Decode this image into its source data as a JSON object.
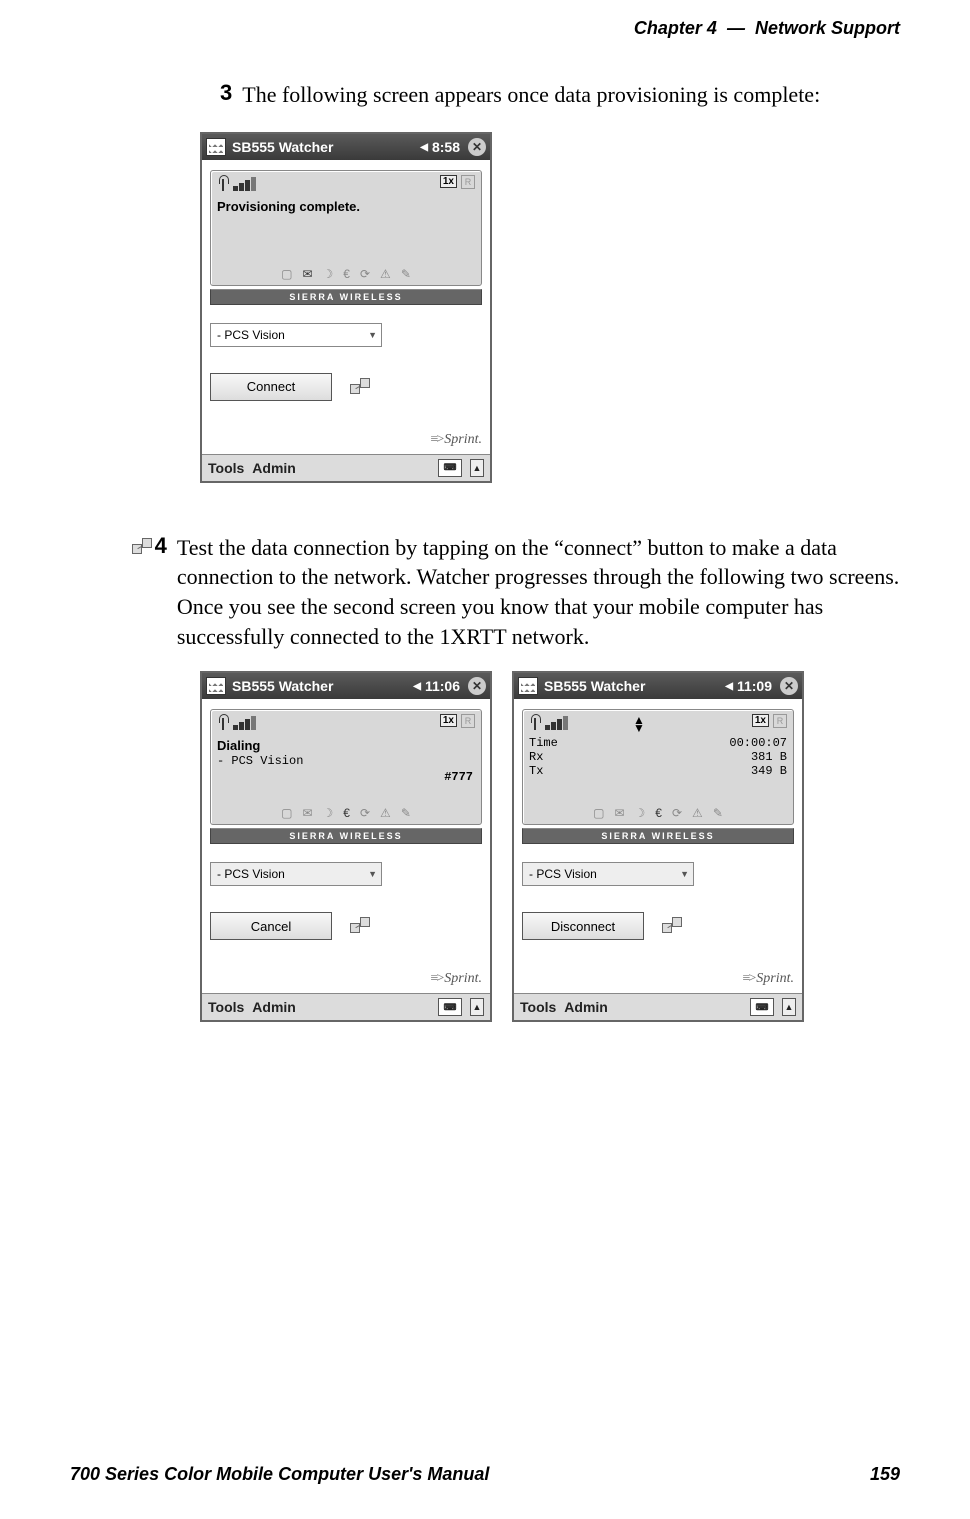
{
  "header": {
    "chapter": "Chapter  4",
    "separator": "—",
    "title": "Network Support"
  },
  "footer": {
    "manual_title": "700 Series Color Mobile Computer User's Manual",
    "page_number": "159"
  },
  "steps": {
    "s3": {
      "num": "3",
      "text": "The following screen appears once data provisioning is complete:"
    },
    "s4": {
      "num": "4",
      "text": "Test the data connection by tapping on the “connect” button to make a data connection to the network. Watcher progresses through the following two screens. Once you see the second screen you know that your mobile computer has successfully connected to the 1XRTT network."
    }
  },
  "common": {
    "app_title": "SB555 Watcher",
    "sierra_label": "SIERRA WIRELESS",
    "dropdown_value": "- PCS Vision",
    "sprint_brand": "Sprint.",
    "menu_tools": "Tools",
    "menu_admin": "Admin",
    "onex_badge": "1x",
    "roam_badge": "R",
    "close_glyph": "✕",
    "speaker_glyph": "◀¦"
  },
  "screen1": {
    "time": "8:58",
    "status": "Provisioning complete.",
    "button": "Connect"
  },
  "screen2": {
    "time": "11:06",
    "status": "Dialing",
    "subline": "- PCS Vision",
    "dial_number": "#777",
    "button": "Cancel"
  },
  "screen3": {
    "time": "11:09",
    "rows": {
      "time_label": "Time",
      "time_value": "00:00:07",
      "rx_label": "Rx",
      "rx_value": "381 B",
      "tx_label": "Tx",
      "tx_value": "349 B"
    },
    "button": "Disconnect"
  }
}
